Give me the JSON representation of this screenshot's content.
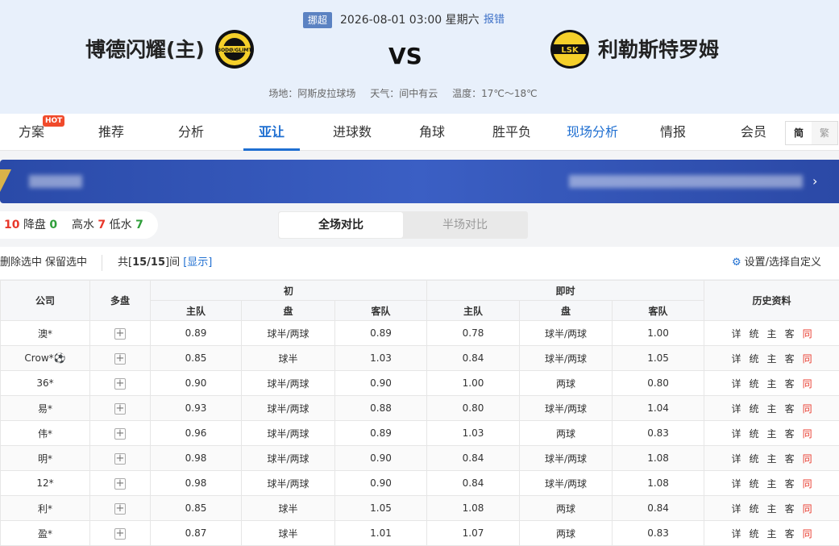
{
  "header": {
    "league": "挪超",
    "datetime": "2026-08-01 03:00 星期六",
    "report": "报错",
    "home": "博德闪耀(主)",
    "vs": "VS",
    "away": "利勒斯特罗姆",
    "venue": "场地：阿斯皮拉球场",
    "weather": "天气：间中有云",
    "temperature": "温度：17℃～18℃",
    "home_logo_text": "BODØ/GLIMT",
    "away_logo_text": "LSK"
  },
  "tabs": [
    {
      "label": "方案",
      "badge": "HOT"
    },
    {
      "label": "推荐"
    },
    {
      "label": "分析"
    },
    {
      "label": "亚让"
    },
    {
      "label": "进球数"
    },
    {
      "label": "角球"
    },
    {
      "label": "胜平负"
    },
    {
      "label": "现场分析"
    },
    {
      "label": "情报"
    },
    {
      "label": "会员"
    }
  ],
  "lang": {
    "simplified": "简",
    "traditional": "繁"
  },
  "stats": {
    "rise_value": "10",
    "drop_label": "降盘",
    "drop_value": "0",
    "high_label": "高水",
    "high_value": "7",
    "low_label": "低水",
    "low_value": "7"
  },
  "toggle": {
    "full": "全场对比",
    "half": "半场对比"
  },
  "toolbar": {
    "delete_selected": "删除选中",
    "keep_selected": "保留选中",
    "total_prefix": "共[",
    "total_count": "15/15",
    "total_suffix": "]间",
    "show": "[显示]",
    "settings": "设置/选择自定义"
  },
  "table": {
    "headers": {
      "company": "公司",
      "multi": "多盘",
      "initial": "初",
      "live": "即时",
      "home": "主队",
      "line": "盘",
      "away": "客队",
      "history": "历史资料"
    },
    "history_links": {
      "detail": "详",
      "stats": "统",
      "home": "主",
      "away": "客",
      "same": "同"
    },
    "rows": [
      {
        "company": "澳*",
        "i_home": "0.89",
        "i_line": "球半/两球",
        "i_away": "0.89",
        "l_home": "0.78",
        "l_line": "球半/两球",
        "l_away": "1.00"
      },
      {
        "company": "Crow*⚽",
        "i_home": "0.85",
        "i_line": "球半",
        "i_away": "1.03",
        "l_home": "0.84",
        "l_line": "球半/两球",
        "l_away": "1.05"
      },
      {
        "company": "36*",
        "i_home": "0.90",
        "i_line": "球半/两球",
        "i_away": "0.90",
        "l_home": "1.00",
        "l_line": "两球",
        "l_away": "0.80"
      },
      {
        "company": "易*",
        "i_home": "0.93",
        "i_line": "球半/两球",
        "i_away": "0.88",
        "l_home": "0.80",
        "l_line": "球半/两球",
        "l_away": "1.04"
      },
      {
        "company": "伟*",
        "i_home": "0.96",
        "i_line": "球半/两球",
        "i_away": "0.89",
        "l_home": "1.03",
        "l_line": "两球",
        "l_away": "0.83"
      },
      {
        "company": "明*",
        "i_home": "0.98",
        "i_line": "球半/两球",
        "i_away": "0.90",
        "l_home": "0.84",
        "l_line": "球半/两球",
        "l_away": "1.08"
      },
      {
        "company": "12*",
        "i_home": "0.98",
        "i_line": "球半/两球",
        "i_away": "0.90",
        "l_home": "0.84",
        "l_line": "球半/两球",
        "l_away": "1.08"
      },
      {
        "company": "利*",
        "i_home": "0.85",
        "i_line": "球半",
        "i_away": "1.05",
        "l_home": "1.08",
        "l_line": "两球",
        "l_away": "0.84"
      },
      {
        "company": "盈*",
        "i_home": "0.87",
        "i_line": "球半",
        "i_away": "1.01",
        "l_home": "1.07",
        "l_line": "两球",
        "l_away": "0.83"
      }
    ]
  }
}
